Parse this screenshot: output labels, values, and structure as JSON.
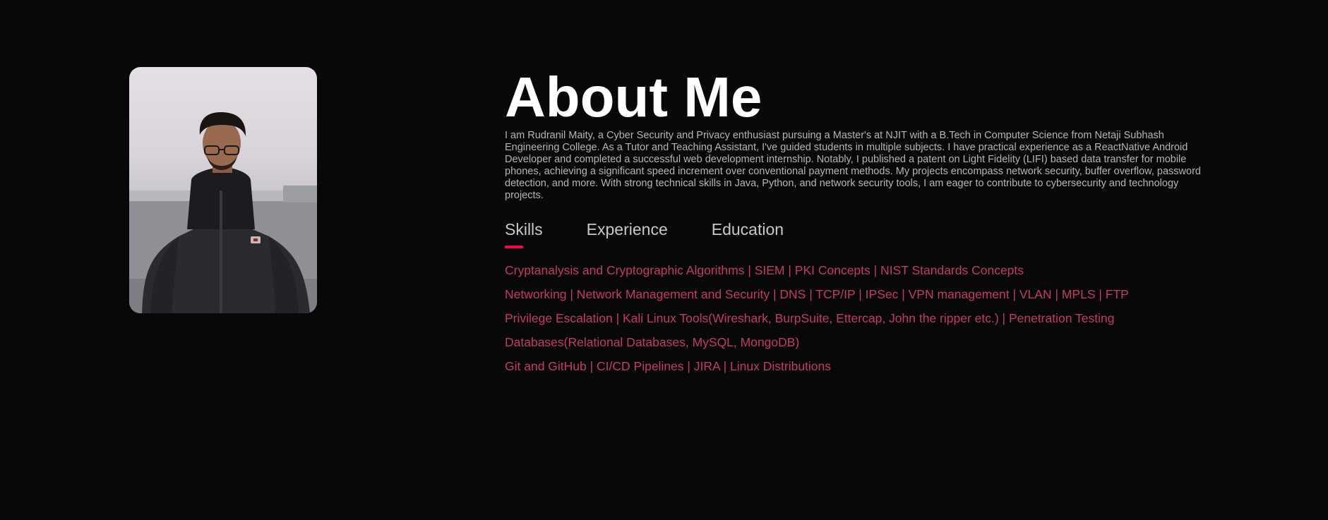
{
  "about": {
    "title": "About Me",
    "bio": "I am Rudranil Maity, a Cyber Security and Privacy enthusiast pursuing a Master's at NJIT with a B.Tech in Computer Science from Netaji Subhash Engineering College. As a Tutor and Teaching Assistant, I've guided students in multiple subjects. I have practical experience as a ReactNative Android Developer and completed a successful web development internship. Notably, I published a patent on Light Fidelity (LIFI) based data transfer for mobile phones, achieving a significant speed increment over conventional payment methods. My projects encompass network security, buffer overflow, password detection, and more. With strong technical skills in Java, Python, and network security tools, I am eager to contribute to cybersecurity and technology projects.",
    "photo_icon": "profile-photo"
  },
  "tabs": [
    {
      "label": "Skills",
      "active": true
    },
    {
      "label": "Experience",
      "active": false
    },
    {
      "label": "Education",
      "active": false
    }
  ],
  "skills": [
    "Cryptanalysis and Cryptographic Algorithms | SIEM | PKI Concepts | NIST Standards Concepts",
    "Networking | Network Management and Security | DNS | TCP/IP | IPSec | VPN management | VLAN | MPLS | FTP",
    "Privilege Escalation | Kali Linux Tools(Wireshark, BurpSuite, Ettercap, John the ripper etc.) | Penetration Testing",
    "Databases(Relational Databases, MySQL, MongoDB)",
    "Git and GitHub | CI/CD Pipelines | JIRA | Linux Distributions"
  ],
  "colors": {
    "background": "#080808",
    "accent": "#ff004f",
    "skill_text": "#c43a6a",
    "bio_text": "#b5b5b5"
  }
}
